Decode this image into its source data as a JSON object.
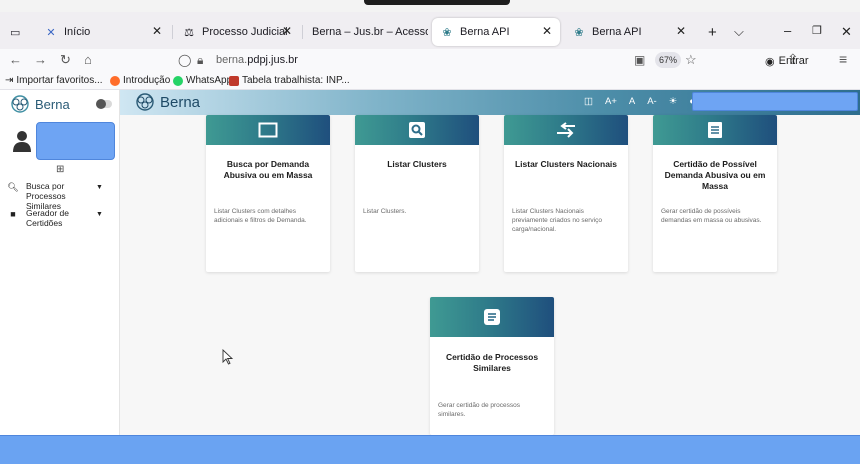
{
  "browser": {
    "tabs": [
      {
        "label": "Início",
        "active": false
      },
      {
        "label": "Processo Judicial",
        "active": false
      },
      {
        "label": "Berna – Jus.br – Acesso Rápido X",
        "active": false
      },
      {
        "label": "Berna API",
        "active": true
      },
      {
        "label": "Berna API",
        "active": false
      }
    ],
    "url_prefix": "berna.",
    "url_domain": "pdpj.jus.br",
    "zoom": "67%",
    "signin_label": "Entrar",
    "bookmarks": [
      "Importar favoritos...",
      "Introdução",
      "WhatsApp",
      "Tabela trabalhista: INP..."
    ]
  },
  "app": {
    "brand": "Berna",
    "sidebar": {
      "expand_symbol": "⊞",
      "items": [
        {
          "label": "Busca por Processos Similares",
          "icon": "search-icon"
        },
        {
          "label": "Gerador de Certidões",
          "icon": "document-icon"
        }
      ]
    },
    "header": {
      "a11y": [
        "A+",
        "A",
        "A-"
      ]
    },
    "cards": [
      {
        "title": "Busca por Demanda Abusiva ou em Massa",
        "desc": "Listar Clusters com detalhes adicionais e filtros de Demanda.",
        "icon": "window-icon"
      },
      {
        "title": "Listar Clusters",
        "desc": "Listar Clusters.",
        "icon": "search-icon"
      },
      {
        "title": "Listar Clusters Nacionais",
        "desc": "Listar Clusters Nacionais previamente criados no serviço carga/nacional.",
        "icon": "arrows-icon"
      },
      {
        "title": "Certidão de Possível Demanda Abusiva ou em Massa",
        "desc": "Gerar certidão de possíveis demandas em massa ou abusivas.",
        "icon": "certificate-icon"
      },
      {
        "title": "Certidão de Processos Similares",
        "desc": "Gerar certidão de processos similares.",
        "icon": "note-icon"
      }
    ],
    "colors": {
      "accent": "#2f7c8a",
      "header_dark": "#1f4f7d",
      "redacted": "#6ea4f3"
    }
  }
}
